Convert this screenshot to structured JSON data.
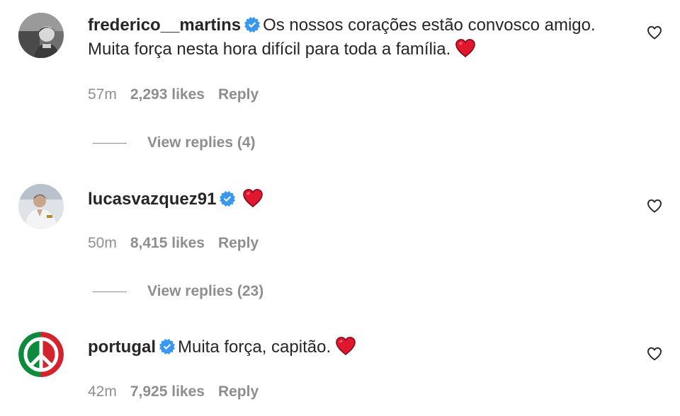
{
  "comments": [
    {
      "username": "frederico__martins",
      "text": "Os nossos corações estão convosco amigo. Muita força nesta hora difícil para toda a família.",
      "time": "57m",
      "likes": "2,293 likes",
      "reply": "Reply",
      "view_replies": "View replies (4)"
    },
    {
      "username": "lucasvazquez91",
      "text": "",
      "time": "50m",
      "likes": "8,415 likes",
      "reply": "Reply",
      "view_replies": "View replies (23)"
    },
    {
      "username": "portugal",
      "text": "Muita força, capitão.",
      "time": "42m",
      "likes": "7,925 likes",
      "reply": "Reply"
    }
  ],
  "colors": {
    "verified": "#3897f0",
    "heart_emoji": "#e0172f",
    "secondary_text": "#8e8e8e",
    "primary_text": "#262626"
  },
  "icons": {
    "verified": "verified-badge-icon",
    "emoji": "red-heart-emoji",
    "like": "heart-outline-icon"
  }
}
